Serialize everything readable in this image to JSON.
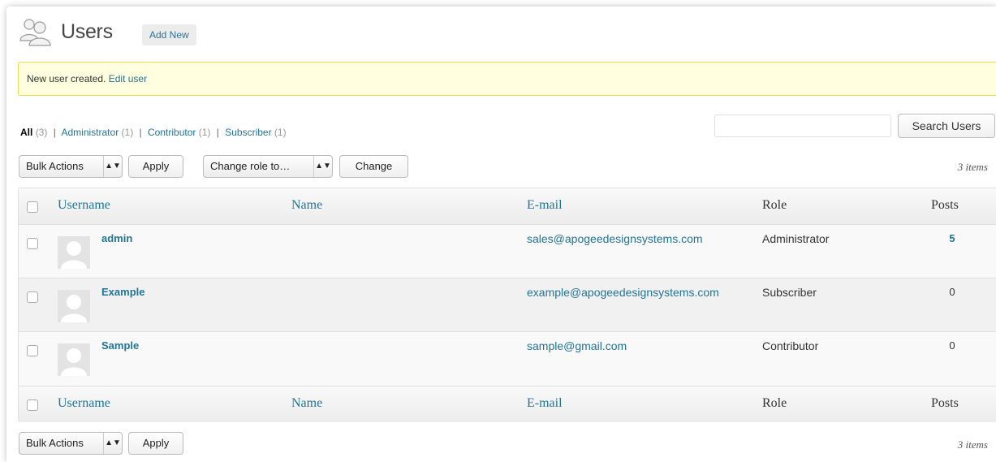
{
  "header": {
    "title": "Users",
    "add_new": "Add New",
    "icon": "users-icon"
  },
  "notice": {
    "text": "New user created.",
    "link": "Edit user"
  },
  "filters": [
    {
      "label": "All",
      "count": "(3)",
      "current": true
    },
    {
      "label": "Administrator",
      "count": "(1)"
    },
    {
      "label": "Contributor",
      "count": "(1)"
    },
    {
      "label": "Subscriber",
      "count": "(1)"
    }
  ],
  "search": {
    "value": "",
    "button": "Search Users"
  },
  "top_controls": {
    "bulk_actions": "Bulk Actions",
    "apply": "Apply",
    "change_role": "Change role to…",
    "change": "Change",
    "items": "3 items"
  },
  "bottom_controls": {
    "bulk_actions": "Bulk Actions",
    "apply": "Apply",
    "items": "3 items"
  },
  "table": {
    "columns": [
      "Username",
      "Name",
      "E-mail",
      "Role",
      "Posts"
    ],
    "rows": [
      {
        "username": "admin",
        "name": "",
        "email": "sales@apogeedesignsystems.com",
        "role": "Administrator",
        "posts": "5"
      },
      {
        "username": "Example",
        "name": "",
        "email": "example@apogeedesignsystems.com",
        "role": "Subscriber",
        "posts": "0"
      },
      {
        "username": "Sample",
        "name": "",
        "email": "sample@gmail.com",
        "role": "Contributor",
        "posts": "0"
      }
    ]
  },
  "colors": {
    "link": "#21759b",
    "notice_bg": "#ffffe0",
    "notice_border": "#e6db55"
  }
}
